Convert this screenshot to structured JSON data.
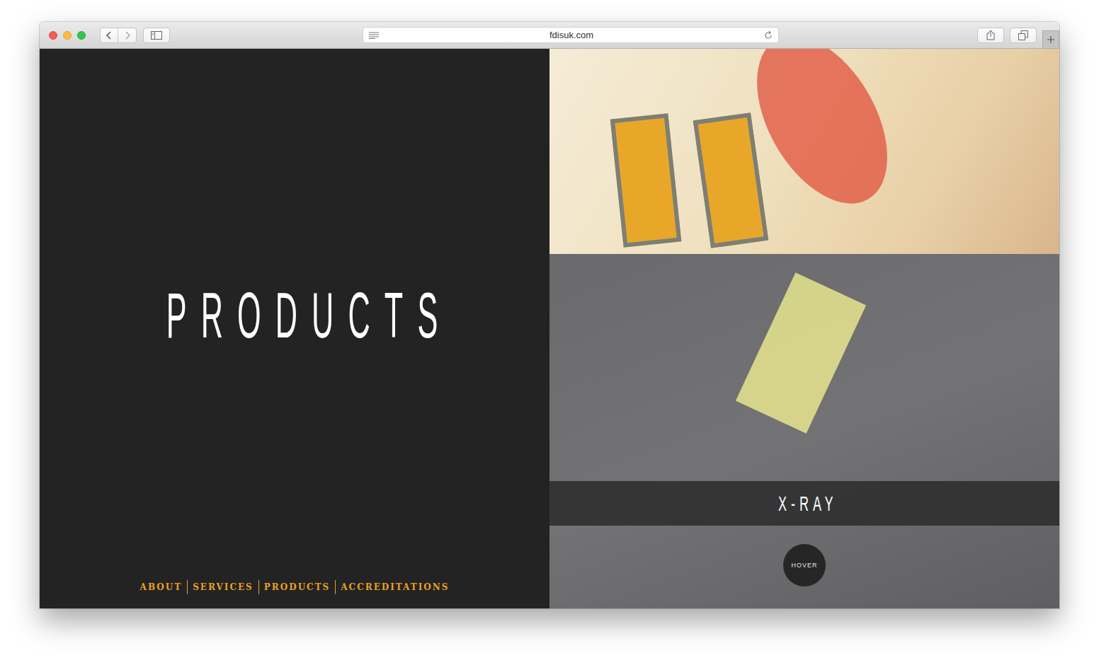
{
  "browser": {
    "url": "fdisuk.com"
  },
  "hero": {
    "title": "PRODUCTS"
  },
  "nav": [
    {
      "label": "ABOUT"
    },
    {
      "label": "SERVICES"
    },
    {
      "label": "PRODUCTS"
    },
    {
      "label": "ACCREDITATIONS"
    }
  ],
  "gallery": {
    "caption": "X-RAY",
    "hover_button": "HOVER"
  }
}
